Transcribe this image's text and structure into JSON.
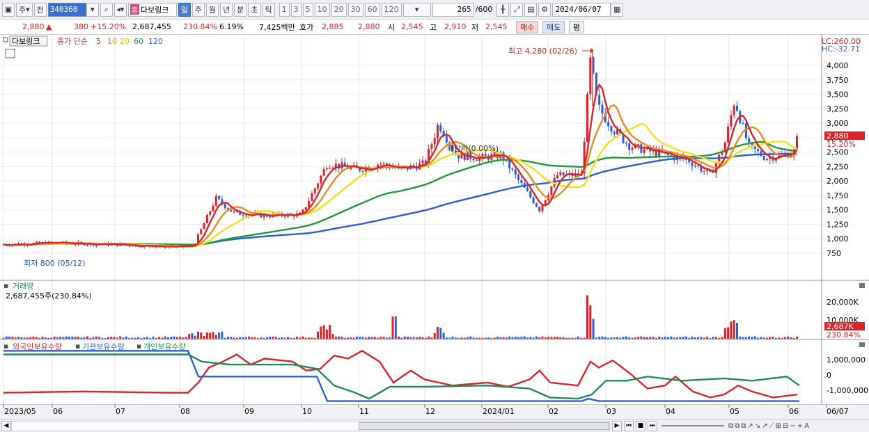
{
  "toolbar": {
    "type_label": "주",
    "prev_label": "전",
    "code": "340360",
    "stock_name": "다보링크",
    "stock_tag": "종",
    "period_buttons": [
      "일",
      "주",
      "월",
      "년",
      "분",
      "초",
      "틱"
    ],
    "interval_buttons": [
      "1",
      "3",
      "5",
      "10",
      "20",
      "30",
      "60",
      "120"
    ],
    "count_value": "265",
    "count_total": "/600",
    "date": "2024/06/07"
  },
  "info": {
    "price": "2,880",
    "change_arrow": "▲",
    "change": "380",
    "change_pct": "+15.20%",
    "volume": "2,687,455",
    "volume_ratio": "230.84%",
    "turnover": "6.19%",
    "amount": "7,425백만",
    "quote_label": "호가",
    "ask": "2,885",
    "bid": "2,880",
    "open_label": "시",
    "open": "2,545",
    "high_label": "고",
    "high": "2,910",
    "low_label": "저",
    "low": "2,545",
    "buy_label": "매수",
    "sell_label": "매도",
    "eval_label": "평"
  },
  "price_panel": {
    "name_tag": "다보링크",
    "legend_prefix": "종가 단순",
    "ma_labels": [
      "5",
      "10",
      "20",
      "60",
      "120"
    ],
    "ma_colors": [
      "#d8242b",
      "#f08a1c",
      "#f4e01c",
      "#1f9a3a",
      "#2a5fd8"
    ],
    "lc": "LC:260.00",
    "hc": "HC:-32.71",
    "current_price_tag": "2,880",
    "current_pct_tag": "15.20%",
    "y_ticks": [
      "4,000",
      "3,750",
      "3,500",
      "3,250",
      "3,000",
      "2,750",
      "2,500",
      "2,250",
      "2,000",
      "1,750",
      "1,500",
      "1,250",
      "1,000",
      "750"
    ],
    "high_annotation": "최고 4,280 (02/26)",
    "low_annotation": "최저 800 (05/12)",
    "mid_annotation": "배당락(0.00%)"
  },
  "volume_panel": {
    "title": "거래량",
    "value_text": "2,687,455주(230.84%)",
    "y_ticks": [
      "20,000K",
      "10,000K"
    ],
    "current_tag": "2,687K",
    "current_pct": "230.84%"
  },
  "holding_panel": {
    "legend": [
      "외국인보유수량",
      "기관보유수량",
      "개인보유수량"
    ],
    "legend_colors": [
      "#d8242b",
      "#2a5fd8",
      "#1f8a5a"
    ],
    "y_ticks": [
      "1,000,000",
      "0",
      "-1,000,000"
    ]
  },
  "x_axis": [
    "2023/05",
    "06",
    "07",
    "08",
    "09",
    "10",
    "11",
    "12",
    "2024/01",
    "02",
    "03",
    "04",
    "05",
    "06",
    "06/07"
  ],
  "chart_data": {
    "type": "line",
    "title": "다보링크",
    "x": [
      "2023/05",
      "06",
      "07",
      "08",
      "09",
      "10",
      "11",
      "12",
      "2024/01",
      "02",
      "03",
      "04",
      "05",
      "06"
    ],
    "series": [
      {
        "name": "종가",
        "values": [
          900,
          920,
          880,
          870,
          1400,
          1450,
          2300,
          2700,
          2450,
          1600,
          2800,
          2350,
          2400,
          2880
        ]
      }
    ],
    "ylim": [
      700,
      4300
    ],
    "high": 4280,
    "low": 800
  }
}
